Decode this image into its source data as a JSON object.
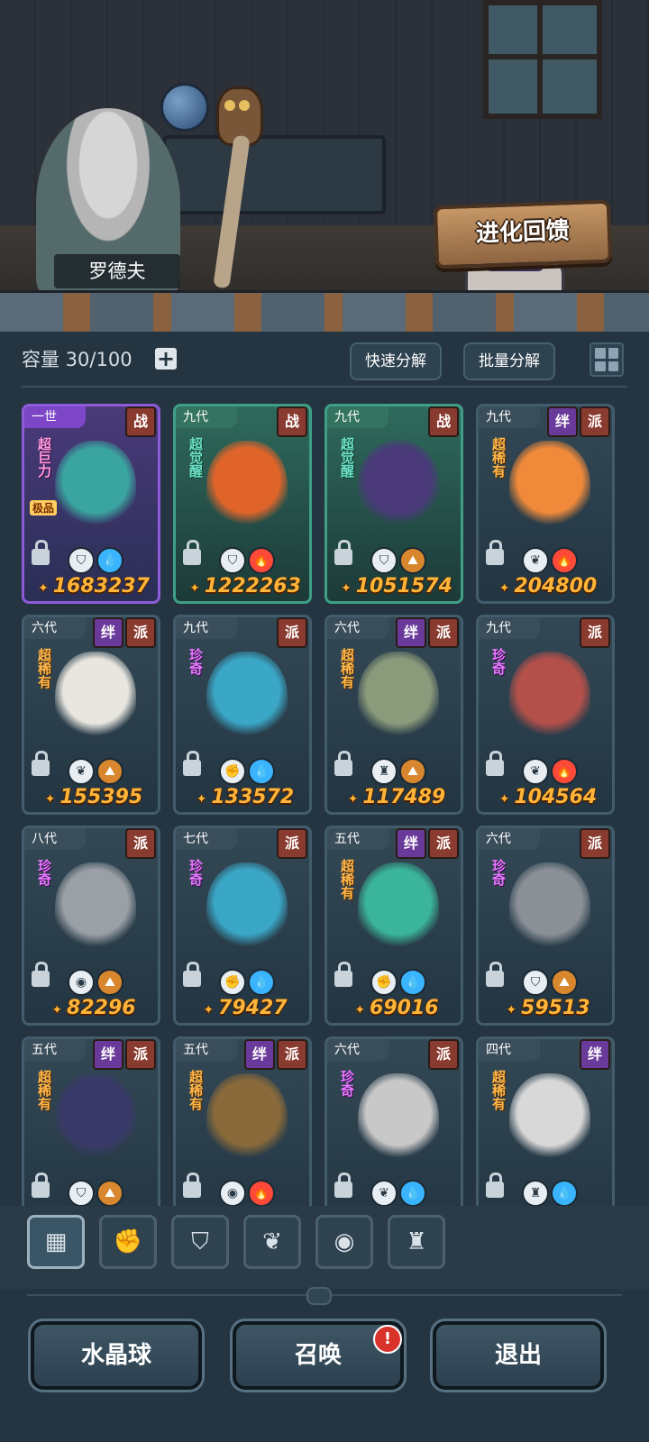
{
  "scene": {
    "npc_name": "罗德夫",
    "evolution_feedback_label": "进化回馈"
  },
  "toolbar": {
    "capacity_label": "容量 30/100",
    "quick_decompose": "快速分解",
    "batch_decompose": "批量分解"
  },
  "cards": [
    {
      "gen": "一世",
      "tags": [
        "战"
      ],
      "rarity": "超巨力",
      "extra": "极品",
      "power": "1683237",
      "el1": "shield-icon",
      "el2": "water-icon",
      "style": "purple",
      "color": "#3aa5a0"
    },
    {
      "gen": "九代",
      "tags": [
        "战"
      ],
      "rarity": "超觉醒",
      "power": "1222263",
      "el1": "shield-icon",
      "el2": "fire-icon",
      "style": "green",
      "color": "#e0642a"
    },
    {
      "gen": "九代",
      "tags": [
        "战"
      ],
      "rarity": "超觉醒",
      "power": "1051574",
      "el1": "shield-icon",
      "el2": "earth-icon",
      "style": "green",
      "color": "#4a3a7a"
    },
    {
      "gen": "九代",
      "tags": [
        "绊",
        "派"
      ],
      "rarity": "超稀有",
      "power": "204800",
      "el1": "leaf-icon",
      "el2": "fire-icon",
      "style": "normal",
      "color": "#f08a3a"
    },
    {
      "gen": "六代",
      "tags": [
        "绊",
        "派"
      ],
      "rarity": "超稀有",
      "power": "155395",
      "el1": "leaf-icon",
      "el2": "earth-icon",
      "style": "normal",
      "color": "#e8e6df"
    },
    {
      "gen": "九代",
      "tags": [
        "派"
      ],
      "rarity": "珍奇",
      "power": "133572",
      "el1": "fist-icon",
      "el2": "water-icon",
      "style": "normal",
      "color": "#3aa7c7"
    },
    {
      "gen": "六代",
      "tags": [
        "绊",
        "派"
      ],
      "rarity": "超稀有",
      "power": "117489",
      "el1": "tower-icon",
      "el2": "earth-icon",
      "style": "normal",
      "color": "#8a9a7a"
    },
    {
      "gen": "九代",
      "tags": [
        "派"
      ],
      "rarity": "珍奇",
      "power": "104564",
      "el1": "leaf-icon",
      "el2": "fire-icon",
      "style": "normal",
      "color": "#b4504a"
    },
    {
      "gen": "八代",
      "tags": [
        "派"
      ],
      "rarity": "珍奇",
      "power": "82296",
      "el1": "eye-icon",
      "el2": "earth-icon",
      "style": "normal",
      "color": "#9aa0a6"
    },
    {
      "gen": "七代",
      "tags": [
        "派"
      ],
      "rarity": "珍奇",
      "power": "79427",
      "el1": "fist-icon",
      "el2": "water-icon",
      "style": "normal",
      "color": "#3aa7c7"
    },
    {
      "gen": "五代",
      "tags": [
        "绊",
        "派"
      ],
      "rarity": "超稀有",
      "power": "69016",
      "el1": "fist-icon",
      "el2": "water-icon",
      "style": "normal",
      "color": "#3ab59a"
    },
    {
      "gen": "六代",
      "tags": [
        "派"
      ],
      "rarity": "珍奇",
      "power": "59513",
      "el1": "shield-icon",
      "el2": "earth-icon",
      "style": "normal",
      "color": "#8a9096"
    },
    {
      "gen": "五代",
      "tags": [
        "绊",
        "派"
      ],
      "rarity": "超稀有",
      "power": "",
      "el1": "shield-icon",
      "el2": "earth-icon",
      "style": "normal",
      "color": "#3a3a6a"
    },
    {
      "gen": "五代",
      "tags": [
        "绊",
        "派"
      ],
      "rarity": "超稀有",
      "power": "",
      "el1": "eye-icon",
      "el2": "fire-icon",
      "style": "normal",
      "color": "#8a6a3a"
    },
    {
      "gen": "六代",
      "tags": [
        "派"
      ],
      "rarity": "珍奇",
      "power": "",
      "el1": "leaf-icon",
      "el2": "water-icon",
      "style": "normal",
      "color": "#c8c8c8"
    },
    {
      "gen": "四代",
      "tags": [
        "绊"
      ],
      "rarity": "超稀有",
      "power": "",
      "el1": "tower-icon",
      "el2": "water-icon",
      "style": "normal",
      "color": "#d8d8d8"
    }
  ],
  "filters": [
    "all-icon",
    "fist-icon",
    "shield-icon",
    "leaf-icon",
    "eye-icon",
    "tower-icon"
  ],
  "bottom": {
    "crystal_ball": "水晶球",
    "summon": "召唤",
    "summon_alert": "!",
    "exit": "退出"
  }
}
